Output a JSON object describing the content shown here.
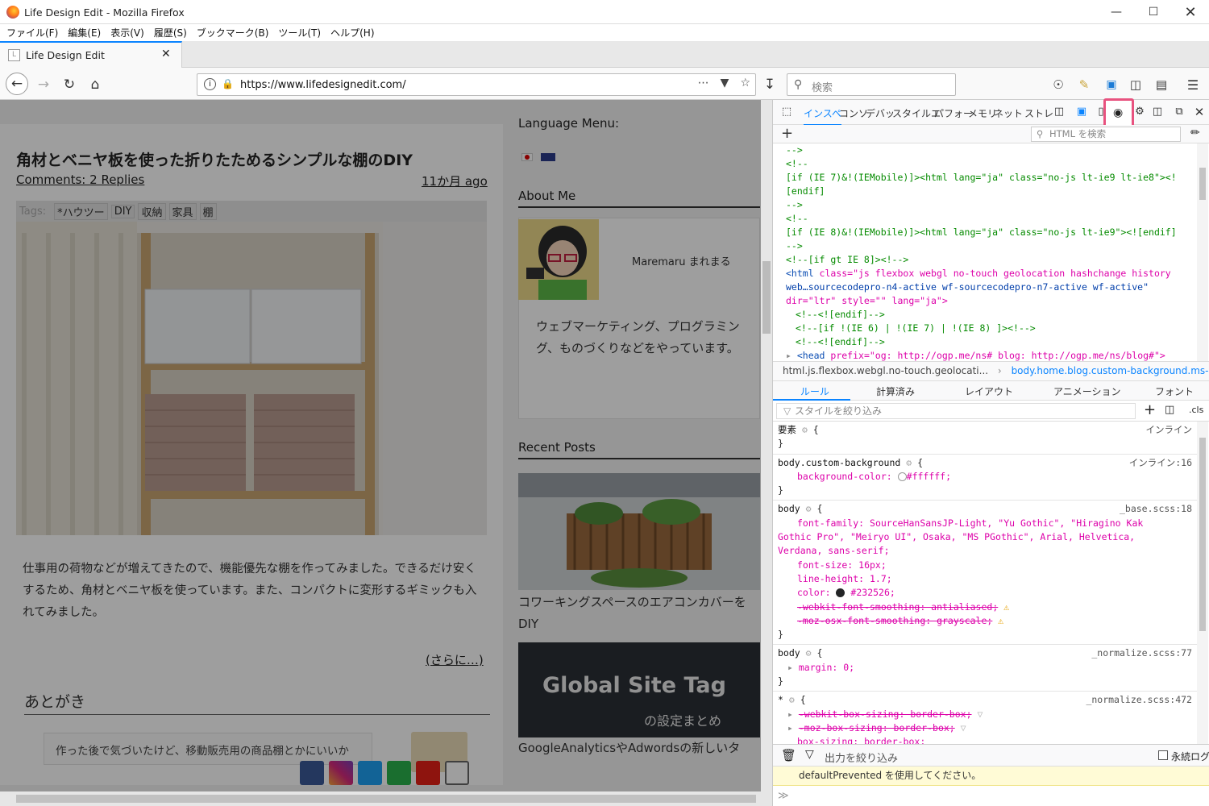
{
  "window": {
    "title": "Life Design Edit - Mozilla Firefox",
    "controls": [
      "minimize-icon",
      "maximize-icon",
      "close-icon"
    ]
  },
  "menu": [
    "ファイル(F)",
    "編集(E)",
    "表示(V)",
    "履歴(S)",
    "ブックマーク(B)",
    "ツール(T)",
    "ヘルプ(H)"
  ],
  "tab": {
    "title": "Life Design Edit",
    "favicon": "L"
  },
  "nav": {
    "url": "https://www.lifedesignedit.com/",
    "search_placeholder": "検索"
  },
  "page": {
    "post_title": "角材とベニヤ板を使った折りたためるシンプルな棚のDIY",
    "comments": "Comments: 2 Replies",
    "date": "11か月 ago",
    "tags_label": "Tags:",
    "tags": [
      "*ハウツー",
      "DIY",
      "収納",
      "家具",
      "棚"
    ],
    "excerpt": "仕事用の荷物などが増えてきたので、機能優先な棚を作ってみました。できるだけ安くするため、角材とベニヤ板を使っています。また、コンパクトに変形するギミックも入れてみました。",
    "more_link": "(さらに…)",
    "afterword_heading": "あとがき",
    "afterword_text": "作った後で気づいたけど、移動販売用の商品棚とかにいいか",
    "sidebar": {
      "language_heading": "Language Menu:",
      "about_heading": "About Me",
      "author_name": "Maremaru まれまる",
      "about_text": "ウェブマーケティング、プログラミング、ものづくりなどをやっています。",
      "recent_heading": "Recent Posts",
      "post1_title": "コワーキングスペースのエアコンカバーをDIY",
      "post2_banner": "Global Site Tag",
      "post2_banner_sub": "の設定まとめ",
      "post2_title": "GoogleAnalyticsやAdwordsの新しいタ"
    },
    "social_icons": [
      "facebook-icon",
      "instagram-icon",
      "twitter-icon",
      "feedly-icon",
      "youtube-icon",
      "mail-icon"
    ]
  },
  "devtools": {
    "tabs": [
      "インスペ",
      "コンソ",
      "デバッ",
      "スタイルエ",
      "パフォー",
      "メモリ",
      "ネット",
      "ストレ"
    ],
    "html_search_placeholder": "HTML を検索",
    "markup": [
      "-->",
      "<!--",
      "[if (IE 7)&!(IEMobile)]><html lang=\"ja\" class=\"no-js lt-ie9 lt-ie8\"><!",
      "[endif]",
      "-->",
      "<!--",
      "[if (IE 8)&!(IEMobile)]><html lang=\"ja\" class=\"no-js lt-ie9\"><![endif]",
      "-->",
      "<!--[if gt IE 8]><!-->"
    ],
    "html_tag_line1": "class=\"js flexbox webgl no-touch geolocation hashchange history",
    "html_tag_line2": "web…sourcecodepro-n4-active wf-sourcecodepro-n7-active wf-active\"",
    "html_tag_line3": "dir=\"ltr\" style=\"\" lang=\"ja\">",
    "markup_tail": [
      "<!--<![endif]-->",
      "<!--[if !(IE 6) | !(IE 7) | !(IE 8) ]><!-->",
      "<!--<![endif]-->"
    ],
    "head_line": "prefix=\"og: http://ogp.me/ns# blog: http://ogp.me/ns/blog#\">",
    "breadcrumb1": "html.js.flexbox.webgl.no-touch.geolocati...",
    "breadcrumb2": "body.home.blog.custom-background.ms-gues...",
    "rule_tabs": [
      "ルール",
      "計算済み",
      "レイアウト",
      "アニメーション",
      "フォント"
    ],
    "filter_placeholder": "スタイルを絞り込み",
    "cls_label": ".cls",
    "rules": {
      "element_sel": "要素",
      "inline": "インライン",
      "r1_sel": "body.custom-background",
      "r1_src": "インライン:16",
      "r1_prop": "background-color",
      "r1_val": "#ffffff",
      "r2_sel": "body",
      "r2_src": "_base.scss:18",
      "r2_ff_prop": "font-family",
      "r2_ff_val1": "SourceHanSansJP-Light, \"Yu Gothic\", \"Hiragino Kak",
      "r2_ff_val2": "Gothic Pro\", \"Meiryo UI\", Osaka, \"MS PGothic\", Arial, Helvetica,",
      "r2_ff_val3": "Verdana, sans-serif",
      "r2_fs": "font-size: 16px;",
      "r2_lh": "line-height: 1.7;",
      "r2_color_prop": "color",
      "r2_color_val": "#232526",
      "r2_wk": "-webkit-font-smoothing: antialiased;",
      "r2_moz": "-moz-osx-font-smoothing: grayscale;",
      "r3_sel": "body",
      "r3_src": "_normalize.scss:77",
      "r3_margin": "margin: 0;",
      "r4_sel": "*",
      "r4_src": "_normalize.scss:472",
      "r4_wk": "-webkit-box-sizing: border-box;",
      "r4_moz": "-moz-box-sizing: border-box;",
      "r4_bs": "box-sizing: border-box;"
    },
    "console_filter": "出力を絞り込み",
    "persist_log": "永続ログ",
    "console_warning": "defaultPrevented を使用してください。",
    "console_prompt": "≫"
  },
  "colors": {
    "accent": "#0a84ff",
    "highlight_box": "#e8527f",
    "devtools_comment": "#058b00",
    "devtools_tag": "#0b4db3",
    "devtools_attr": "#dd00a9"
  }
}
